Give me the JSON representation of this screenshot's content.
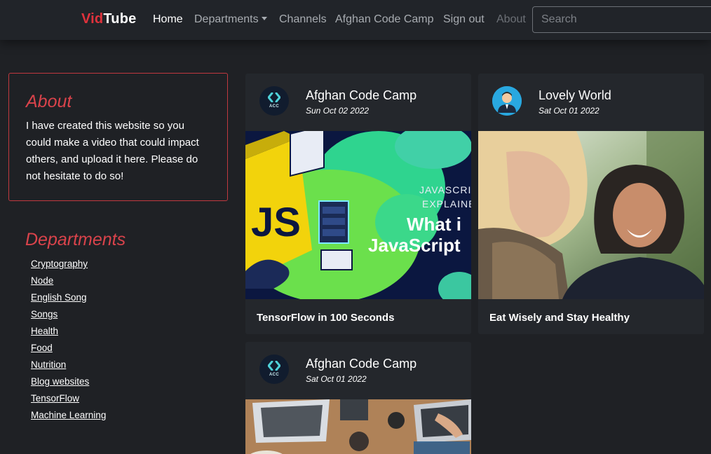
{
  "brand": {
    "part1": "Vid",
    "part2": "Tube"
  },
  "nav": {
    "home": "Home",
    "departments": "Departments",
    "channels": "Channels",
    "afghan_code_camp": "Afghan Code Camp",
    "sign_out": "Sign out",
    "about": "About"
  },
  "search": {
    "placeholder": "Search",
    "value": ""
  },
  "sidebar": {
    "about_title": "About",
    "about_text": "I have created this website so you could make a video that could impact others, and upload it here. Please do not hesitate to do so!",
    "departments_title": "Departments",
    "departments": [
      "Cryptography",
      "Node",
      "English Song",
      "Songs",
      "Health",
      "Food",
      "Nutrition",
      "Blog websites",
      "TensorFlow",
      "Machine Learning"
    ]
  },
  "videos": [
    {
      "channel": "Afghan Code Camp",
      "avatar_label": "ACC",
      "date": "Sun Oct 02 2022",
      "title": "TensorFlow in 100 Seconds",
      "thumb_text": {
        "line1": "JAVASCRI",
        "line2": "EXPLAINE",
        "line3": "What i",
        "line4": "JavaScript",
        "js": "JS"
      }
    },
    {
      "channel": "Lovely World",
      "date": "Sat Oct 01 2022",
      "title": "Eat Wisely and Stay Healthy"
    },
    {
      "channel": "Afghan Code Camp",
      "avatar_label": "ACC",
      "date": "Sat Oct 01 2022",
      "title": ""
    }
  ],
  "colors": {
    "background": "#1f2125",
    "brand_red": "#e0323c",
    "heading_red": "#d9434b",
    "card_bg": "#24272c"
  }
}
